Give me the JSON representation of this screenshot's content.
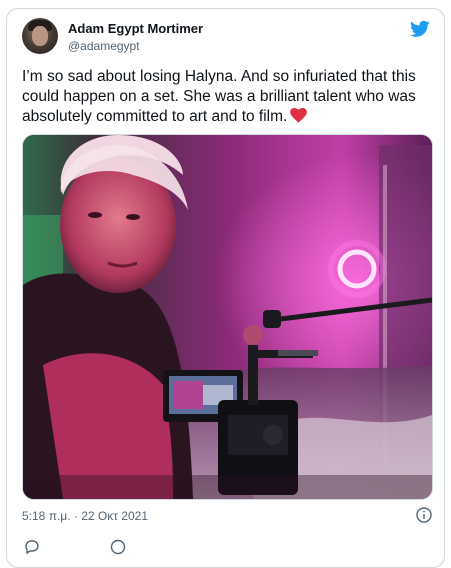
{
  "tweet": {
    "author": {
      "display_name": "Adam Egypt Mortimer",
      "handle": "@adamegypt"
    },
    "brand_logo": "twitter-bird-icon",
    "text": "I’m so sad about losing Halyna. And so infuriated that this could happen on a set. She was a brilliant talent who was absolutely committed to art and to film.",
    "text_emoji": "red-heart-icon",
    "media": {
      "type": "photo"
    },
    "timestamp": "5:18 π.μ. · 22 Οκτ 2021",
    "info_icon": "info-icon"
  },
  "colors": {
    "brand_blue": "#1d9bf0",
    "text_primary": "#0f1419",
    "text_secondary": "#536471",
    "border": "#cfd9de",
    "heart_red": "#e0245e"
  }
}
